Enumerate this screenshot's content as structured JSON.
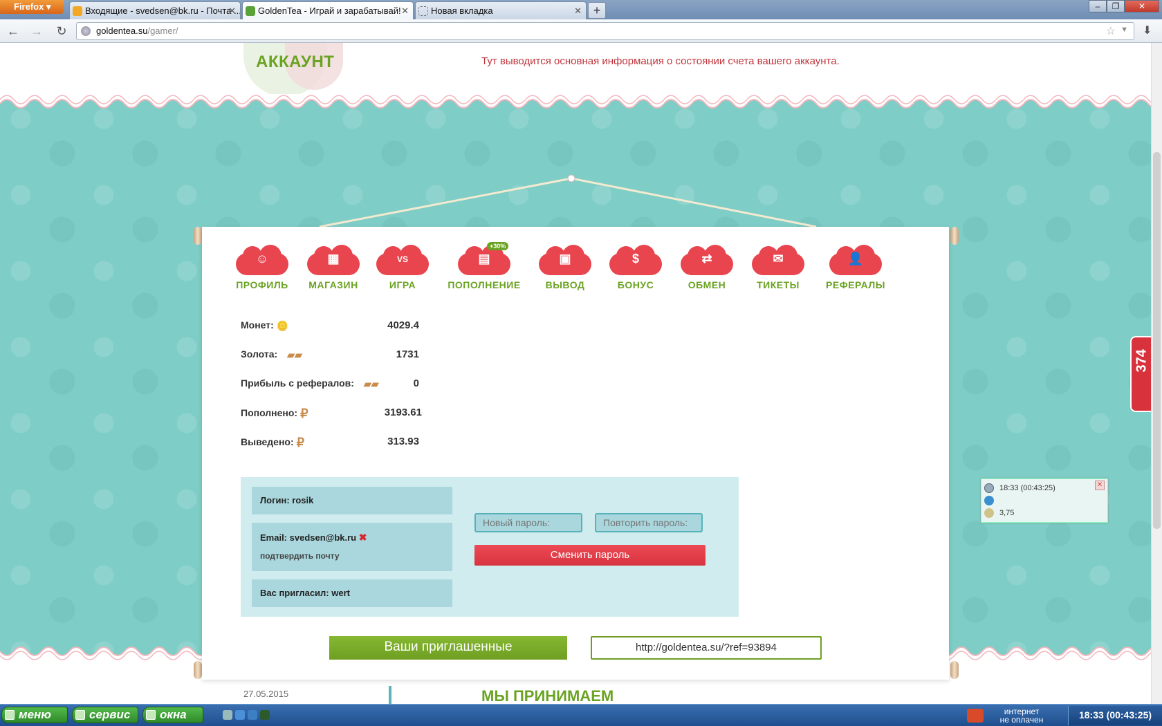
{
  "browser": {
    "menu_button": "Firefox",
    "tabs": [
      {
        "title": "Входящие - svedsen@bk.ru - Почта ..."
      },
      {
        "title": "GoldenTea - Играй и зарабатывай!"
      },
      {
        "title": "Новая вкладка"
      }
    ],
    "url_host": "goldentea.su",
    "url_path": "/gamer/"
  },
  "header": {
    "title": "АККАУНТ",
    "description": "Тут выводится основная информация о состоянии счета вашего аккаунта."
  },
  "menu": [
    {
      "label": "ПРОФИЛЬ",
      "icon": "profile-icon"
    },
    {
      "label": "МАГАЗИН",
      "icon": "shop-icon"
    },
    {
      "label": "ИГРА",
      "icon": "game-vs-icon"
    },
    {
      "label": "ПОПОЛНЕНИЕ",
      "icon": "deposit-icon",
      "badge": "+30%"
    },
    {
      "label": "ВЫВОД",
      "icon": "wallet-icon"
    },
    {
      "label": "БОНУС",
      "icon": "dollar-icon"
    },
    {
      "label": "ОБМЕН",
      "icon": "exchange-icon"
    },
    {
      "label": "ТИКЕТЫ",
      "icon": "envelope-icon"
    },
    {
      "label": "РЕФЕРАЛЫ",
      "icon": "referrals-icon"
    }
  ],
  "stats": [
    {
      "label": "Монет:",
      "value": "4029.4",
      "icon": "coins-icon"
    },
    {
      "label": "Золота:",
      "value": "1731",
      "icon": "gold-bars-icon"
    },
    {
      "label": "Прибыль с рефералов:",
      "value": "0",
      "icon": "gold-bars-icon"
    },
    {
      "label": "Пополнено:",
      "value": "3193.61",
      "icon": "ruble-icon"
    },
    {
      "label": "Выведено:",
      "value": "313.93",
      "icon": "ruble-icon"
    }
  ],
  "account": {
    "login": "Логин: rosik",
    "email": "Email: svedsen@bk.ru",
    "confirm_email": "подтвердить почту",
    "invited_by": "Вас пригласил: wert",
    "new_password_placeholder": "Новый пароль:",
    "repeat_password_placeholder": "Повторить пароль:",
    "change_password_button": "Сменить пароль"
  },
  "referrals": {
    "button": "Ваши приглашенные",
    "link": "http://goldentea.su/?ref=93894"
  },
  "side_counter": "374",
  "mini_widget": {
    "time": "18:33 (00:43:25)",
    "value": "3,75"
  },
  "bottom": {
    "date": "27.05.2015",
    "title": "МЫ ПРИНИМАЕМ"
  },
  "taskbar": {
    "buttons": [
      "меню",
      "сервис",
      "окна"
    ],
    "net_status_line1": "интернет",
    "net_status_line2": "не оплачен",
    "clock": "18:33 (00:43:25)"
  },
  "colors": {
    "brand_green": "#6aa322",
    "accent_red": "#e8454f",
    "teal_bg": "#7ecdc6"
  }
}
